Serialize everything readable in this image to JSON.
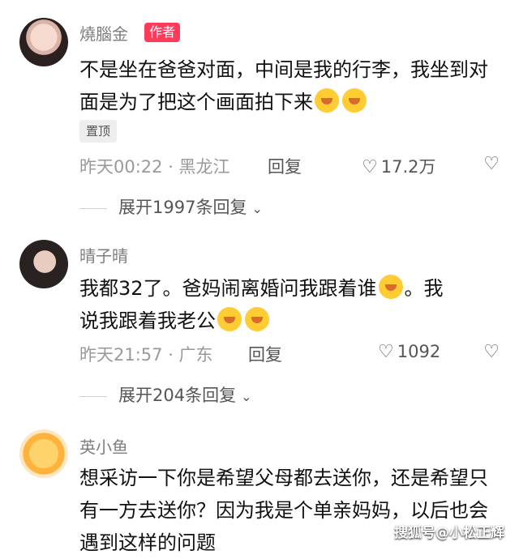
{
  "comments": [
    {
      "username": "燒腦金",
      "author_badge": "作者",
      "text_before_emoji": "不是坐在爸爸对面，中间是我的行李，我坐到对面是为了把这个画面拍下来",
      "pin_label": "置顶",
      "time_location": "昨天00:22 · 黑龙江",
      "reply_label": "回复",
      "likes": "17.2万",
      "expand_label": "展开1997条回复"
    },
    {
      "username": "晴子晴",
      "text_line1": "我都32了。爸妈闹离婚问我跟着谁",
      "text_line1_after": "。我",
      "text_line2": "说我跟着我老公",
      "time_location": "昨天21:57 · 广东",
      "reply_label": "回复",
      "likes": "1092",
      "expand_label": "展开204条回复"
    },
    {
      "username": "英小鱼",
      "text": "想采访一下你是希望父母都去送你，还是希望只有一方去送你？因为我是个单亲妈妈，以后也会遇到这样的问题"
    }
  ],
  "watermark": "搜狐号@小松正辉"
}
